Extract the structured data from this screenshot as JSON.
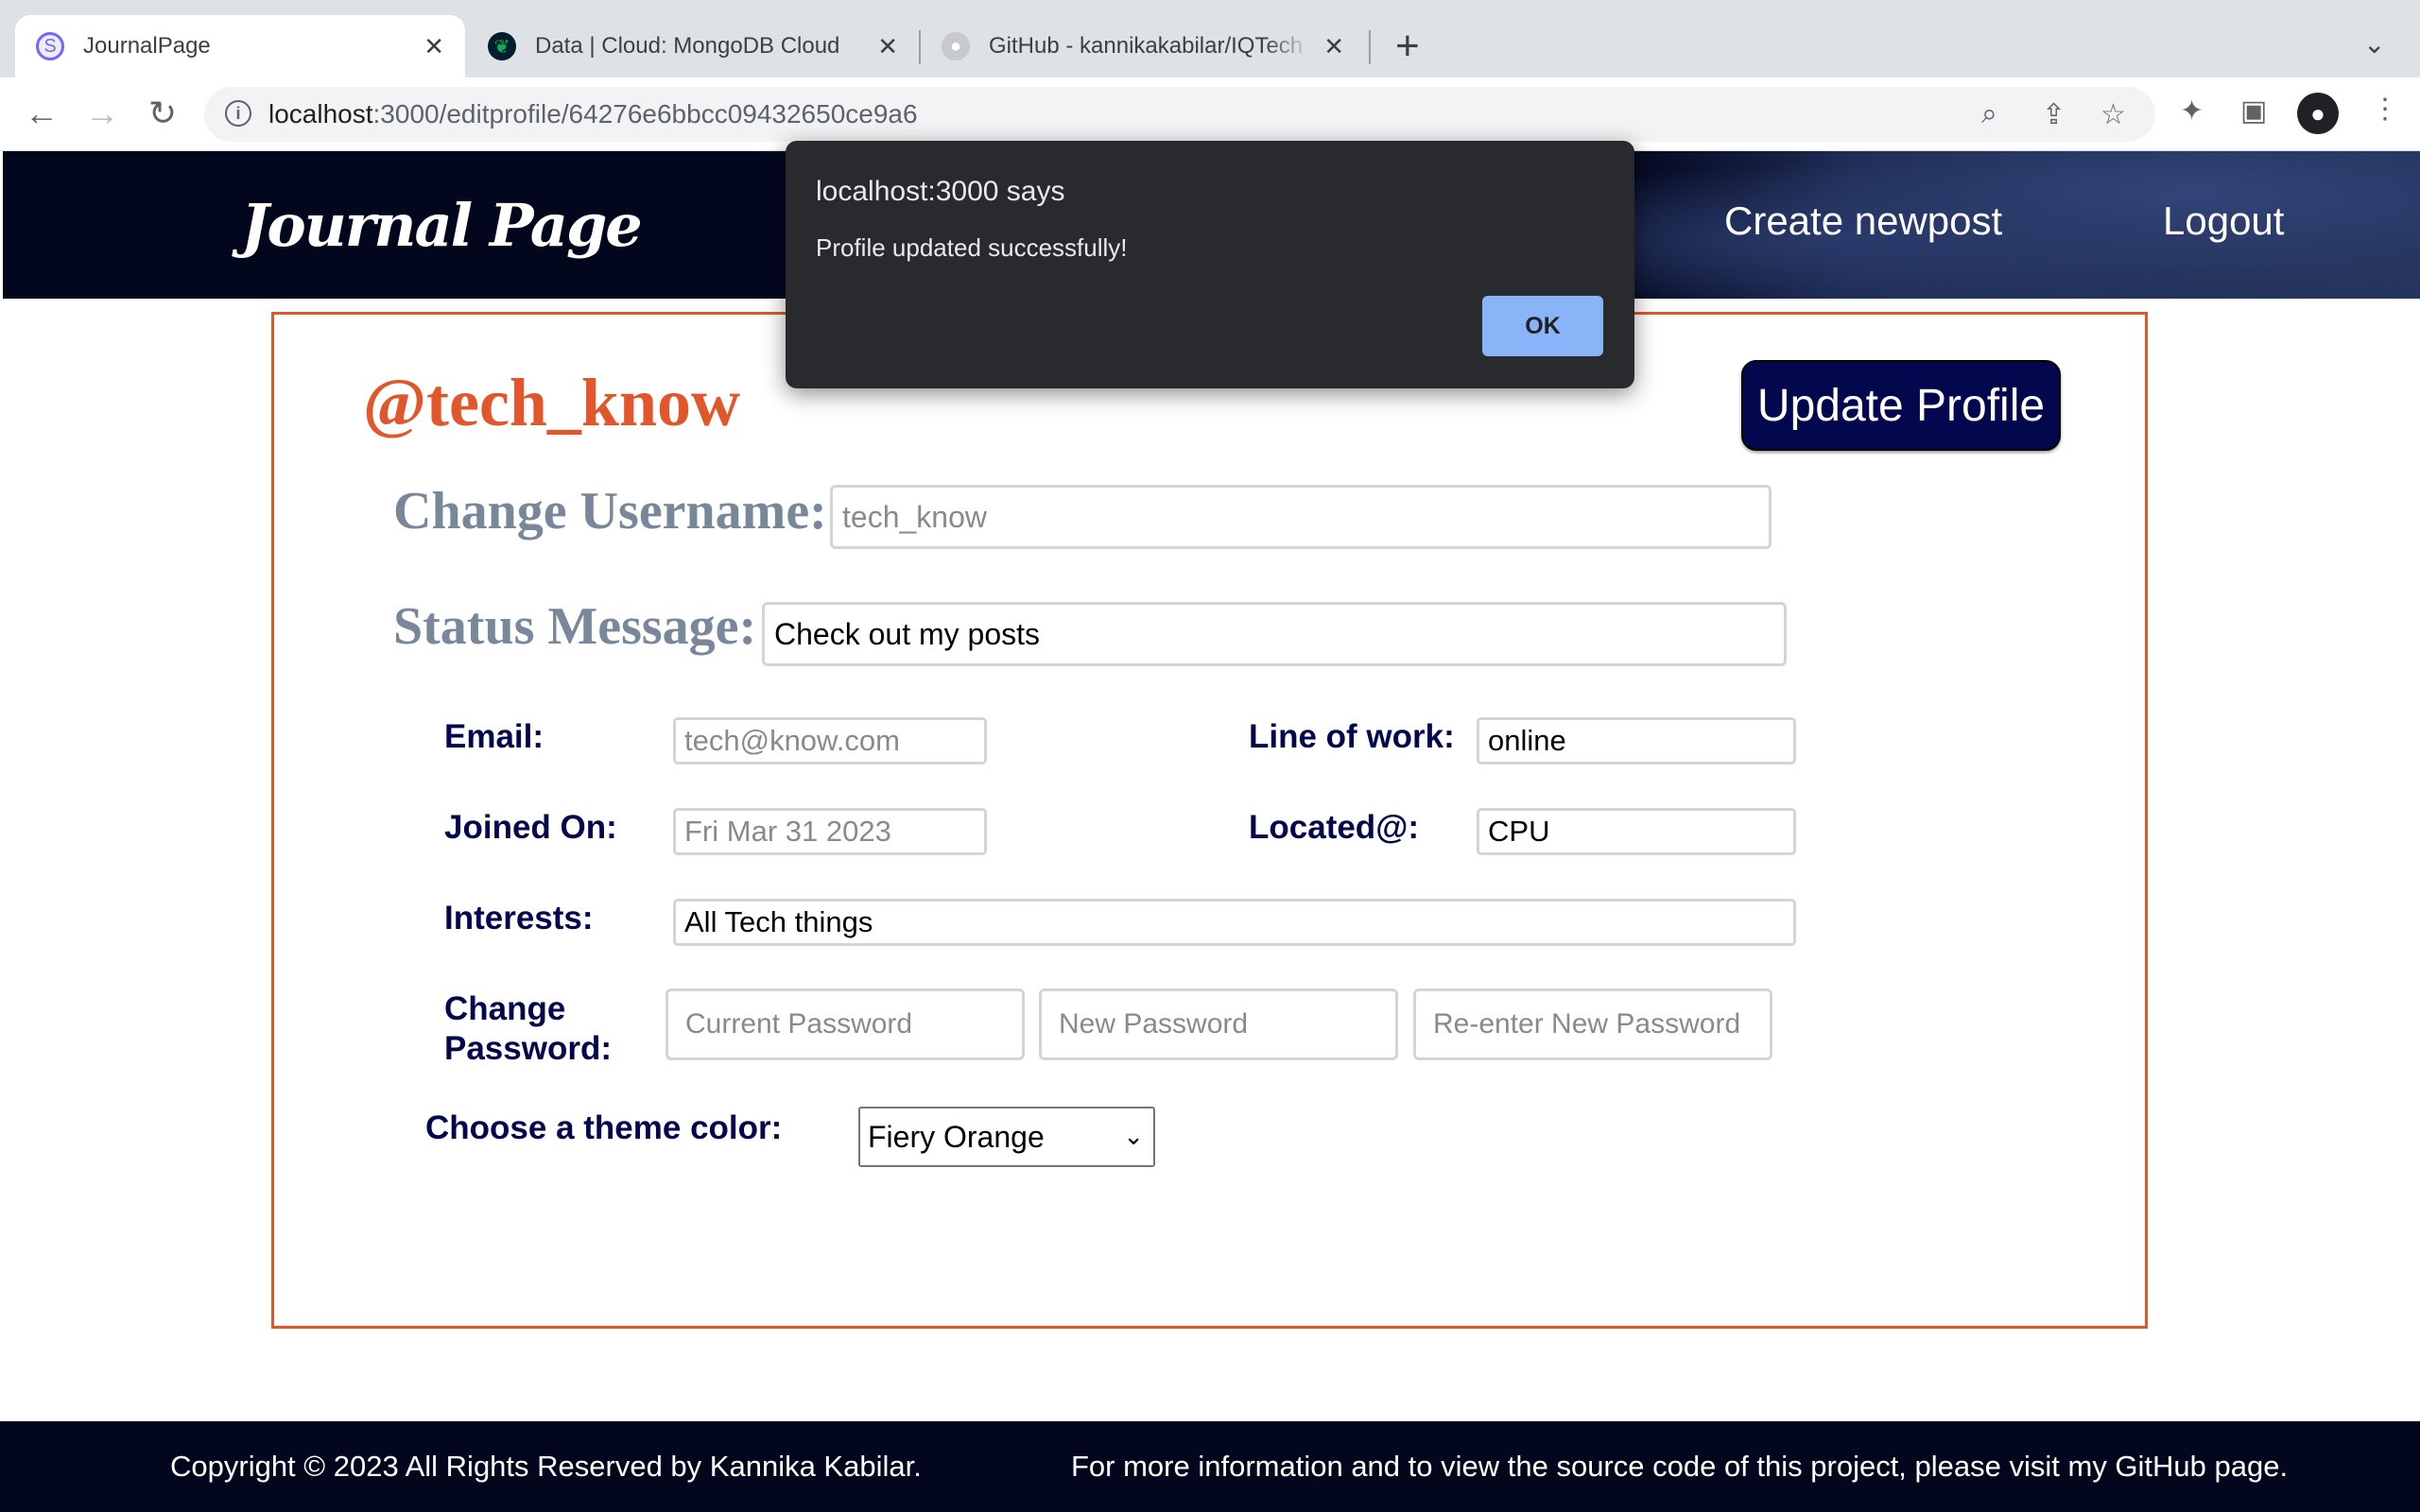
{
  "browser": {
    "tabs": [
      {
        "title": "JournalPage",
        "icon": "journalpage-favicon"
      },
      {
        "title": "Data | Cloud: MongoDB Cloud",
        "icon": "mongodb-leaf-icon"
      },
      {
        "title": "GitHub - kannikakabilar/IQTech",
        "icon": "github-icon"
      }
    ],
    "new_tab": "+",
    "address": {
      "host": "localhost",
      "path": ":3000/editprofile/64276e6bbcc09432650ce9a6"
    }
  },
  "header": {
    "logo": "Journal Page",
    "nav": {
      "create": "Create newpost",
      "logout": "Logout"
    }
  },
  "profile": {
    "handle": "@tech_know",
    "update_button": "Update Profile",
    "username_label": "Change Username:",
    "username_value": "tech_know",
    "status_label": "Status Message:",
    "status_value": "Check out my posts",
    "email_label": "Email:",
    "email_value": "tech@know.com",
    "work_label": "Line of work:",
    "work_value": "online",
    "joined_label": "Joined On:",
    "joined_value": "Fri Mar 31 2023",
    "located_label": "Located@:",
    "located_value": "CPU",
    "interests_label": "Interests:",
    "interests_value": "All Tech things",
    "password_label_1": "Change",
    "password_label_2": "Password:",
    "current_password_placeholder": "Current Password",
    "new_password_placeholder": "New Password",
    "reenter_password_placeholder": "Re-enter New Password",
    "theme_label": "Choose a theme color:",
    "theme_value": "Fiery Orange"
  },
  "footer": {
    "copyright": "Copyright © 2023 All Rights Reserved by Kannika Kabilar.",
    "info": "For more information and to view the source code of this project, please visit my GitHub page."
  },
  "dialog": {
    "title": "localhost:3000 says",
    "message": "Profile updated successfully!",
    "ok": "OK"
  },
  "colors": {
    "accent": "#e2562c",
    "navy": "#03074e",
    "header_bg": "#03071e"
  }
}
